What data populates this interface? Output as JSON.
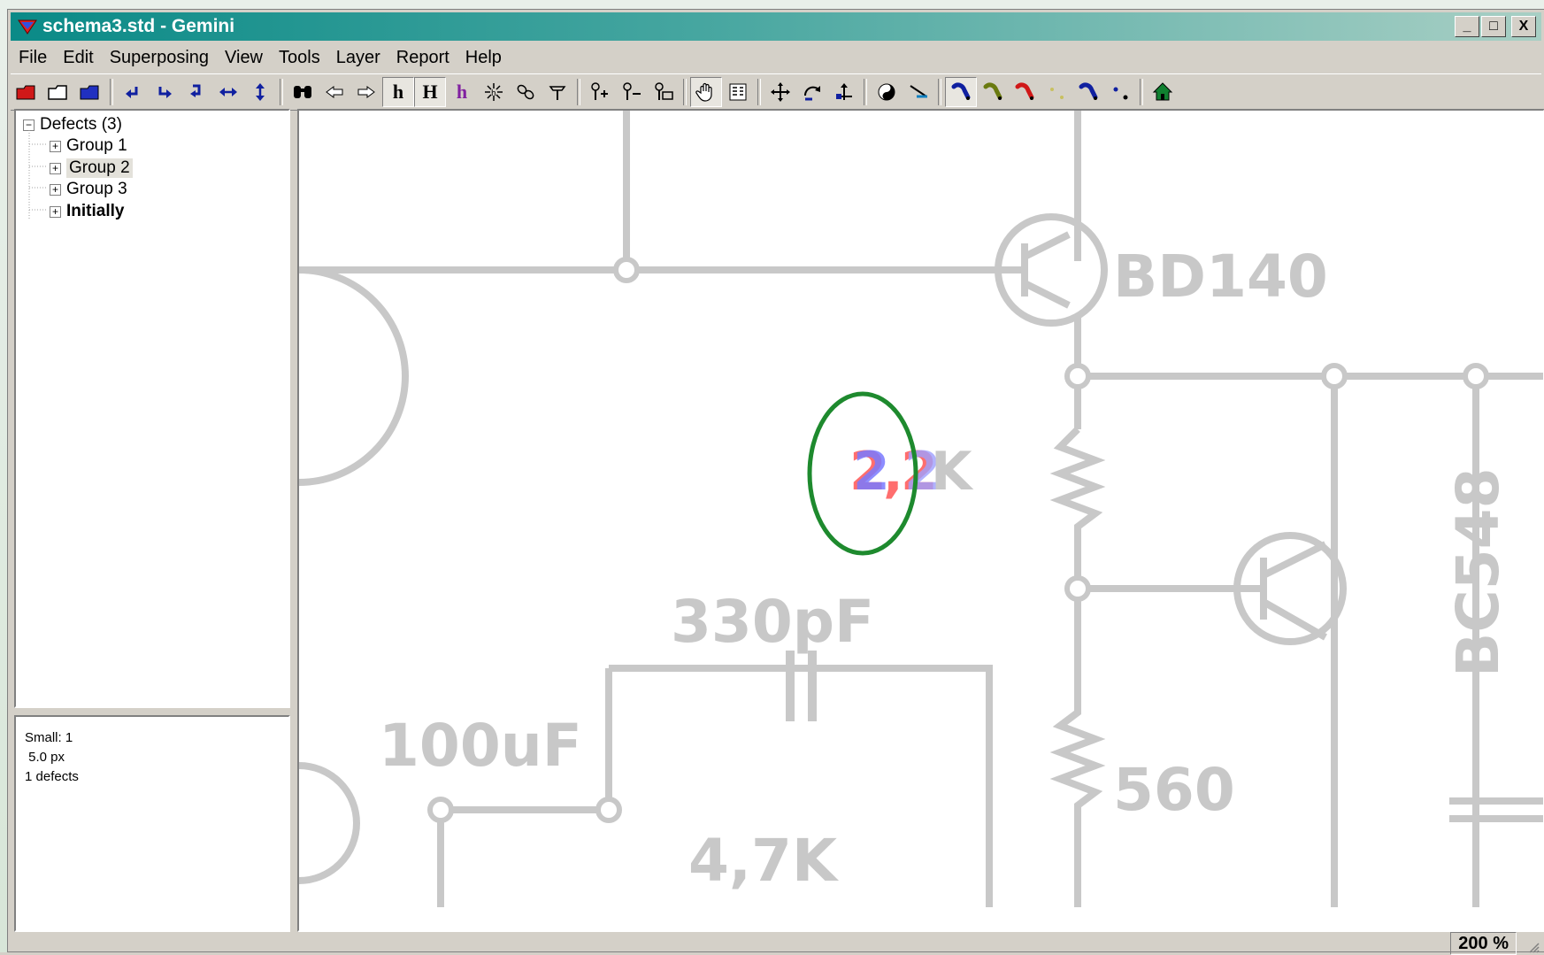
{
  "window": {
    "title": "schema3.std - Gemini",
    "minimize": "_",
    "maximize": "□",
    "close": "X"
  },
  "menu": [
    "File",
    "Edit",
    "Superposing",
    "View",
    "Tools",
    "Layer",
    "Report",
    "Help"
  ],
  "toolbar": {
    "icons": [
      "open-red-folder-icon",
      "open-folder-icon",
      "open-blue-folder-icon",
      "undo-icon",
      "redo-icon",
      "redo-all-icon",
      "flip-horizontal-icon",
      "flip-vertical-icon",
      "find-icon",
      "previous-icon",
      "next-icon",
      "small-h-icon",
      "large-h-icon",
      "purple-h-icon",
      "sparkle-icon",
      "link-icon",
      "tool-icon",
      "pin-add-icon",
      "pin-remove-icon",
      "pin-box-icon",
      "hand-icon",
      "list-icon",
      "move-icon",
      "rotate-icon",
      "shift-icon",
      "yin-yang-icon",
      "line-icon",
      "blue-marker-icon",
      "green-marker-icon",
      "red-marker-icon",
      "dot-marker-icon",
      "blue-marker-2-icon",
      "dots-icon",
      "home-icon"
    ],
    "labels": {
      "small_h": "h",
      "large_h": "H",
      "purple_h": "h"
    }
  },
  "tree": {
    "root": {
      "label": "Defects (3)",
      "toggle": "−"
    },
    "items": [
      {
        "label": "Group 1",
        "toggle": "+"
      },
      {
        "label": "Group 2",
        "toggle": "+"
      },
      {
        "label": "Group 3",
        "toggle": "+"
      },
      {
        "label": "Initially",
        "toggle": "+"
      }
    ]
  },
  "info": {
    "line1": "Small: 1",
    "line2": " 5.0 px",
    "line3": "1 defects"
  },
  "schematic": {
    "labels": {
      "bd140": "BD140",
      "r1_a": "2",
      "r1_b": ",",
      "r1_c": "2",
      "r1_d": "K",
      "c330": "330pF",
      "c100": "100uF",
      "r560": "560",
      "r47": "4,7K",
      "bc548": "BC548"
    },
    "colors": {
      "wire": "#c8c8c8",
      "defect_ring": "#1e8a2e",
      "diff_red": "#ff6e6e",
      "diff_blue": "#7a7aff"
    }
  },
  "status": {
    "zoom": "200 %"
  }
}
